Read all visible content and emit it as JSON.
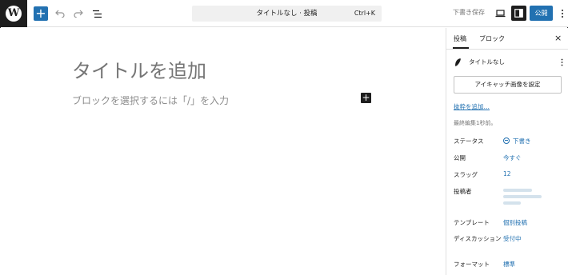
{
  "toolbar": {
    "logo": "W",
    "inserter_label": "+",
    "document_title": "タイトルなし · 投稿",
    "shortcut": "Ctrl+K",
    "save_draft": "下書き保存",
    "publish": "公開",
    "accent_color": "#2271b1"
  },
  "editor": {
    "title_placeholder": "タイトルを追加",
    "block_placeholder": "ブロックを選択するには「/」を入力",
    "block_inserter_label": "+"
  },
  "sidebar": {
    "tabs": [
      {
        "label": "投稿"
      },
      {
        "label": "ブロック"
      }
    ],
    "close_label": "×",
    "post_name": "タイトルなし",
    "featured_image_button": "アイキャッチ画像を設定",
    "excerpt_link": "抜粋を追加…",
    "last_edited": "最終編集1秒前。",
    "meta": [
      {
        "label": "ステータス",
        "value": "下書き"
      },
      {
        "label": "公開",
        "value": "今すぐ"
      },
      {
        "label": "スラッグ",
        "value": "12"
      },
      {
        "label": "投稿者",
        "value": ""
      },
      {
        "label": "テンプレート",
        "value": "個別投稿"
      },
      {
        "label": "ディスカッション",
        "value": "受付中"
      },
      {
        "label": "フォーマット",
        "value": "標準"
      }
    ]
  },
  "icons": {
    "logo": "wordpress-logo-icon",
    "undo": "undo-icon",
    "redo": "redo-icon",
    "list_view": "list-view-icon",
    "preview": "desktop-preview-icon",
    "settings": "settings-sidebar-icon",
    "more": "more-vertical-icon",
    "post": "pen-icon",
    "status": "draft-status-icon"
  }
}
